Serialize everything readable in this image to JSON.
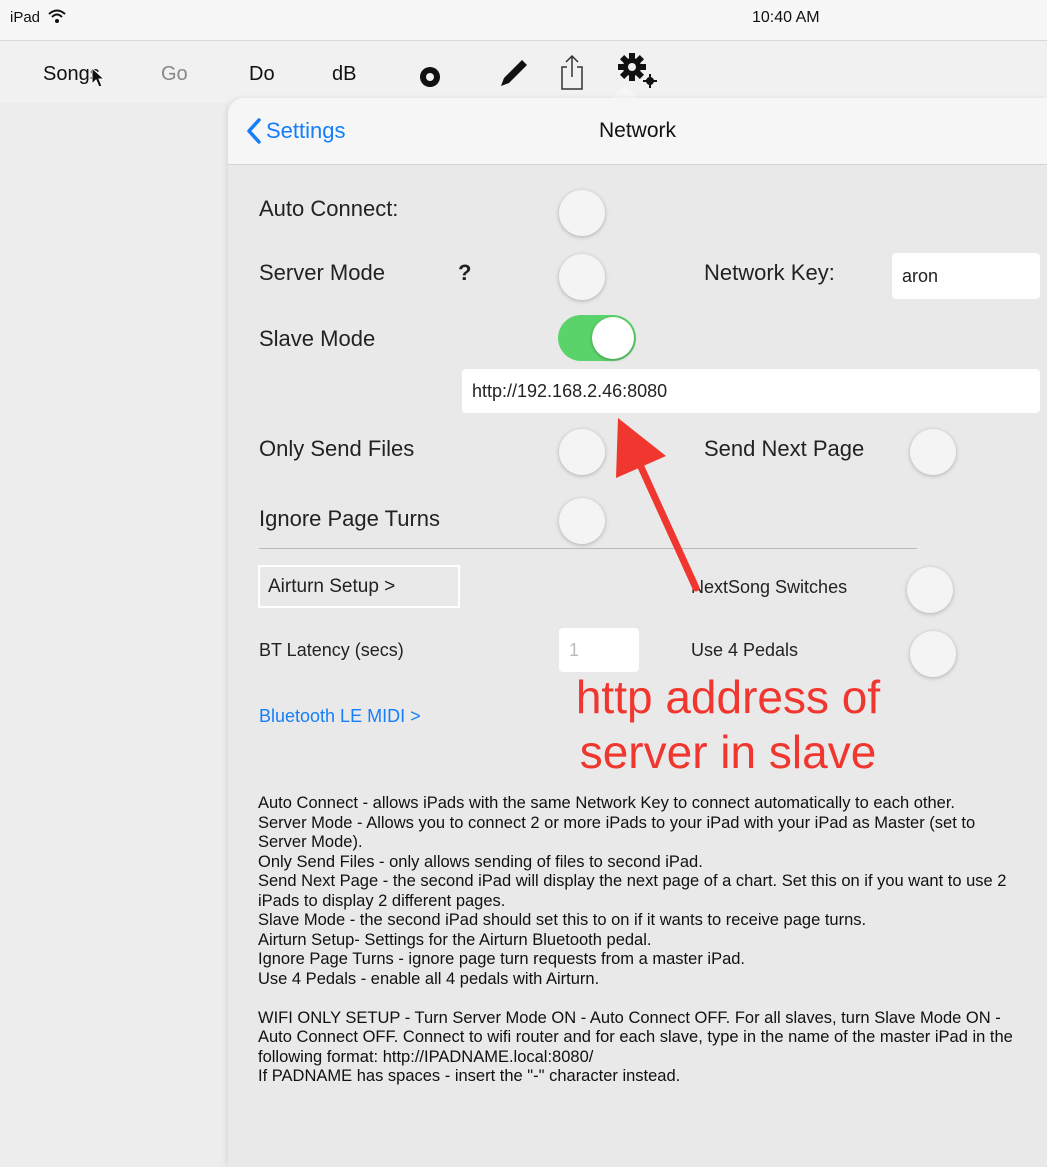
{
  "status_bar": {
    "carrier": "iPad",
    "time": "10:40 AM"
  },
  "toolbar": {
    "songs": "Songs",
    "go": "Go",
    "do": "Do",
    "db": "dB",
    "icons": [
      "record-icon",
      "pencil-icon",
      "share-icon",
      "gear-icon"
    ]
  },
  "nav": {
    "back_label": "Settings",
    "title": "Network"
  },
  "settings": {
    "auto_connect": {
      "label": "Auto Connect:",
      "on": false
    },
    "server_mode": {
      "label": "Server Mode",
      "help": "?",
      "on": false
    },
    "network_key": {
      "label": "Network Key:",
      "value": "aron"
    },
    "slave_mode": {
      "label": "Slave Mode",
      "on": true
    },
    "server_url": {
      "value": "http://192.168.2.46:8080"
    },
    "only_send_files": {
      "label": "Only Send Files",
      "on": false
    },
    "send_next_page": {
      "label": "Send Next Page",
      "on": false
    },
    "ignore_page_turns": {
      "label": "Ignore Page Turns",
      "on": false
    },
    "airturn_setup": {
      "label": "Airturn Setup  >"
    },
    "nextsong_switches": {
      "label": "NextSong Switches",
      "on": false
    },
    "bt_latency": {
      "label": "BT Latency (secs)",
      "placeholder": "1"
    },
    "use_4_pedals": {
      "label": "Use 4 Pedals",
      "on": false
    },
    "bluetooth_le_midi": {
      "label": "Bluetooth LE MIDI >"
    }
  },
  "annotation": {
    "line1": "http address of",
    "line2": "server in slave"
  },
  "help_text": "Auto Connect - allows iPads with the same Network Key to connect automatically to each other.\nServer Mode - Allows you to connect 2 or more iPads to your iPad with your iPad as Master (set to Server Mode).\nOnly Send Files - only allows sending of files to second iPad.\nSend Next Page - the second iPad will display the next page of a chart. Set this on if you want to use 2 iPads to display 2 different pages.\nSlave Mode - the second iPad should set this to on if it wants to receive page turns.\nAirturn Setup- Settings for the Airturn Bluetooth pedal.\nIgnore Page Turns - ignore page turn requests from a master iPad.\nUse 4 Pedals - enable all 4 pedals with Airturn.\n\nWIFI ONLY SETUP - Turn Server Mode ON - Auto Connect OFF. For all slaves, turn Slave Mode ON - Auto Connect OFF. Connect to wifi router and for each slave, type in the name of the master iPad in the following format: http://IPADNAME.local:8080/\nIf PADNAME has spaces - insert the \"-\" character instead.",
  "colors": {
    "accent": "#147efb",
    "toggle_on": "#5bd36b",
    "annotation": "#f0372f"
  }
}
